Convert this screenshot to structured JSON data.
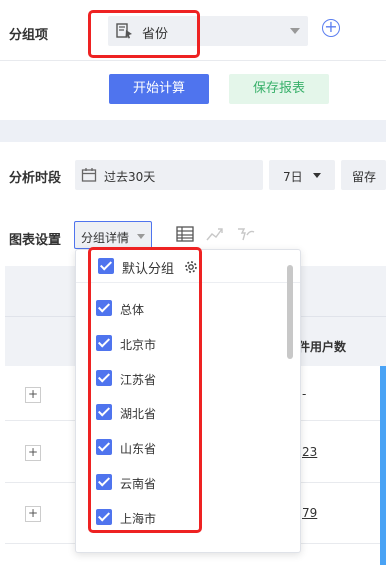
{
  "group": {
    "label": "分组项",
    "selected": "省份"
  },
  "actions": {
    "calculate": "开始计算",
    "save_report": "保存报表"
  },
  "period": {
    "label": "分析时段",
    "range": "过去30天",
    "granularity": "7日",
    "retention_fragment": "留存"
  },
  "chart_settings": {
    "label": "图表设置",
    "mode": "分组详情"
  },
  "table": {
    "column_fragment": "件用户数",
    "cells": [
      "-",
      "23",
      "79"
    ]
  },
  "dropdown": {
    "default_group_label": "默认分组",
    "items": [
      "总体",
      "北京市",
      "江苏省",
      "湖北省",
      "山东省",
      "云南省",
      "上海市"
    ]
  },
  "colors": {
    "accent": "#4f74ee",
    "highlight": "#ee2222",
    "save_bg": "#e4f6ea",
    "save_text": "#38b06a"
  }
}
